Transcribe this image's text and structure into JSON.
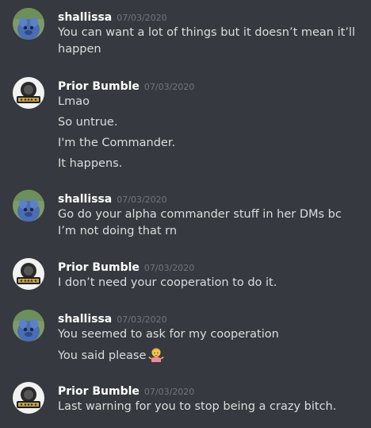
{
  "messages": [
    {
      "username": "shallissa",
      "timestamp": "07/03/2020",
      "lines": [
        "You can want a lot of things but it doesn’t mean it’ll happen"
      ]
    },
    {
      "username": "Prior Bumble",
      "timestamp": "07/03/2020",
      "lines": [
        "Lmao",
        "So untrue.",
        "I'm the Commander.",
        "It happens."
      ]
    },
    {
      "username": "shallissa",
      "timestamp": "07/03/2020",
      "lines": [
        "Go do your alpha commander stuff in her DMs bc I’m not doing that rn"
      ]
    },
    {
      "username": "Prior Bumble",
      "timestamp": "07/03/2020",
      "lines": [
        "I don’t need your cooperation to do it."
      ]
    },
    {
      "username": "shallissa",
      "timestamp": "07/03/2020",
      "lines": [
        "You seemed to ask for my cooperation",
        "You said please"
      ]
    },
    {
      "username": "Prior Bumble",
      "timestamp": "07/03/2020",
      "lines": [
        "Last warning for you to stop being a crazy bitch."
      ]
    }
  ],
  "icons": {
    "shrug_emoji": "person-shrugging-emoji-icon",
    "avatar_shallissa": "blue-creature-avatar-icon",
    "avatar_prior_bumble": "gold-crest-avatar-icon"
  },
  "colors": {
    "background": "#36393f",
    "username": "#ffffff",
    "timestamp": "#72767d",
    "message_text": "#dcddde"
  }
}
